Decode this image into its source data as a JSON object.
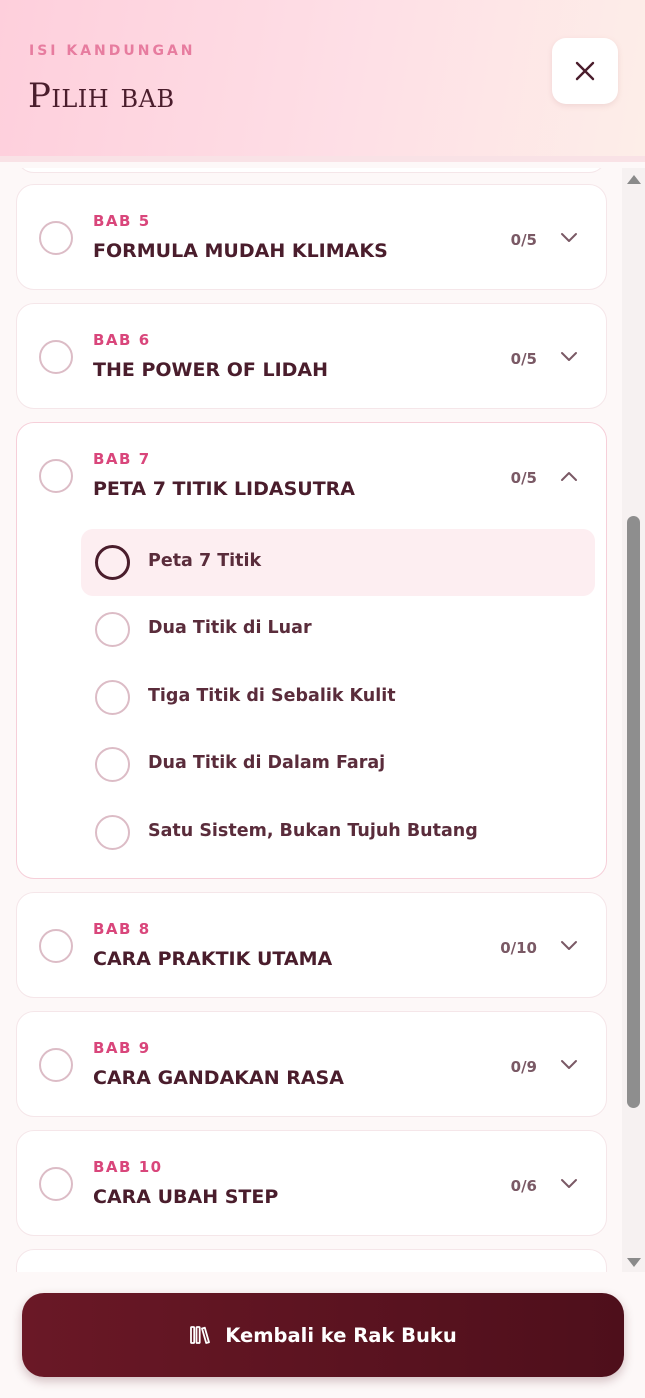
{
  "header": {
    "kicker": "ISI KANDUNGAN",
    "title": "Pilih bab",
    "close_icon": "close-icon"
  },
  "chapters": [
    {
      "bab": "BAB 5",
      "name": "FORMULA MUDAH KLIMAKS",
      "count": "0/5",
      "expanded": false
    },
    {
      "bab": "BAB 6",
      "name": "THE POWER OF LIDAH",
      "count": "0/5",
      "expanded": false
    },
    {
      "bab": "BAB 7",
      "name": "PETA 7 TITIK LIDASUTRA",
      "count": "0/5",
      "expanded": true,
      "lessons": [
        {
          "label": "Peta 7 Titik",
          "active": true
        },
        {
          "label": "Dua Titik di Luar",
          "active": false
        },
        {
          "label": "Tiga Titik di Sebalik Kulit",
          "active": false
        },
        {
          "label": "Dua Titik di Dalam Faraj",
          "active": false
        },
        {
          "label": "Satu Sistem, Bukan Tujuh Butang",
          "active": false
        }
      ]
    },
    {
      "bab": "BAB 8",
      "name": "CARA PRAKTIK UTAMA",
      "count": "0/10",
      "expanded": false
    },
    {
      "bab": "BAB 9",
      "name": "CARA GANDAKAN RASA",
      "count": "0/9",
      "expanded": false
    },
    {
      "bab": "BAB 10",
      "name": "CARA UBAH STEP",
      "count": "0/6",
      "expanded": false
    }
  ],
  "footer": {
    "back_label": "Kembali ke Rak Buku",
    "back_icon": "books-icon"
  },
  "colors": {
    "accent": "#d9467b",
    "primary_dark": "#4a1d2c",
    "button_bg": "#5c1420"
  }
}
